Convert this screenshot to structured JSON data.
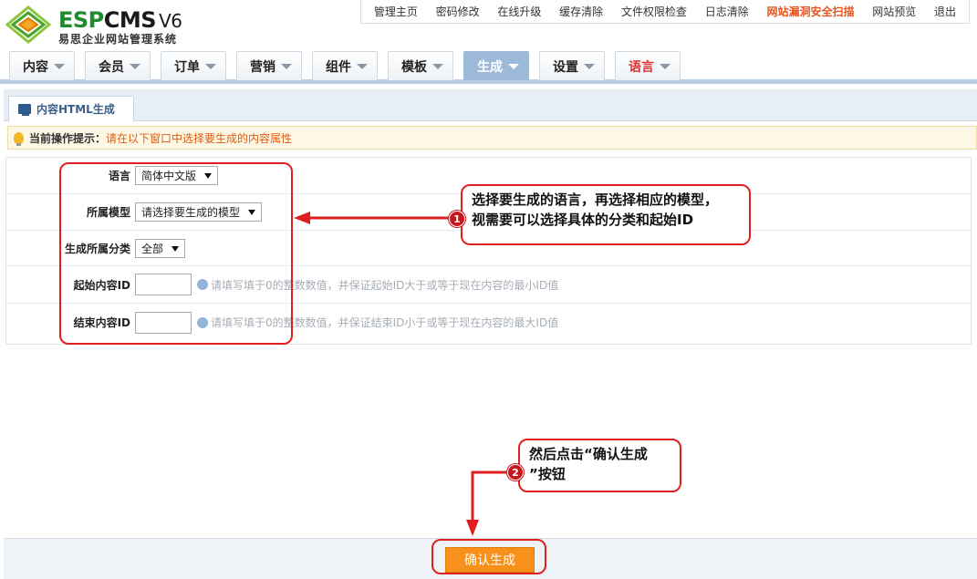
{
  "header": {
    "brand_esp": "ESP",
    "brand_cms": "CMS",
    "brand_version": "V6",
    "subtitle": "易思企业网站管理系统",
    "top_links": [
      {
        "label": "管理主页"
      },
      {
        "label": "密码修改"
      },
      {
        "label": "在线升级"
      },
      {
        "label": "缓存清除"
      },
      {
        "label": "文件权限检查"
      },
      {
        "label": "日志清除"
      },
      {
        "label": "网站漏洞安全扫描"
      },
      {
        "label": "网站预览"
      },
      {
        "label": "退出"
      }
    ]
  },
  "nav": {
    "tabs": [
      {
        "label": "内容"
      },
      {
        "label": "会员"
      },
      {
        "label": "订单"
      },
      {
        "label": "营销"
      },
      {
        "label": "组件"
      },
      {
        "label": "模板"
      },
      {
        "label": "生成"
      },
      {
        "label": "设置"
      },
      {
        "label": "语言"
      }
    ],
    "active_tab": "生成"
  },
  "panel": {
    "subtab_label": "内容HTML生成",
    "notice_label": "当前操作提示：",
    "notice_text": "请在以下窗口中选择要生成的内容属性"
  },
  "form": {
    "language": {
      "label": "语言",
      "value": "简体中文版"
    },
    "model": {
      "label": "所属模型",
      "value": "请选择要生成的模型"
    },
    "category": {
      "label": "生成所属分类",
      "value": "全部"
    },
    "start_id": {
      "label": "起始内容ID",
      "value": "",
      "hint": "请填写填于0的整数数值，并保证起始ID大于或等于现在内容的最小ID值"
    },
    "end_id": {
      "label": "结束内容ID",
      "value": "",
      "hint": "请填写填于0的整数数值，并保证结束ID小于或等于现在内容的最大ID值"
    }
  },
  "annotations": {
    "step1_number": "1",
    "step1_line1": "选择要生成的语言，再选择相应的模型，",
    "step1_line2": "视需要可以选择具体的分类和起始ID",
    "step2_number": "2",
    "step2_line1": "然后点击“确认生成",
    "step2_line2": "”按钮",
    "color": "#e02020"
  },
  "footer": {
    "confirm_label": "确认生成"
  }
}
